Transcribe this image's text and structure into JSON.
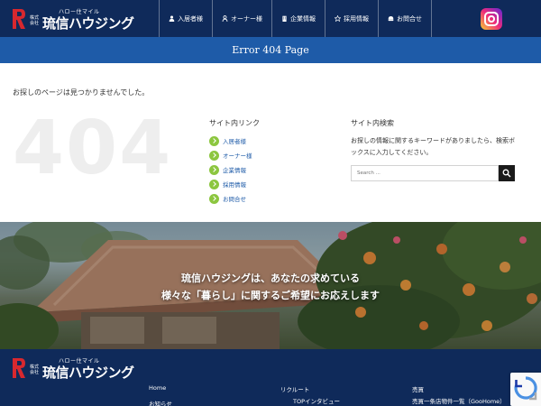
{
  "header": {
    "logo_tagline": "ハロー住マイル",
    "logo_small": "株式会社",
    "logo_name": "琉信ハウジング",
    "nav": [
      {
        "label": "入居者様",
        "icon": "person-icon"
      },
      {
        "label": "オーナー様",
        "icon": "owner-icon"
      },
      {
        "label": "企業情報",
        "icon": "building-icon"
      },
      {
        "label": "採用情報",
        "icon": "star-icon"
      },
      {
        "label": "お問合せ",
        "icon": "contact-icon"
      }
    ],
    "social_icon": "instagram-icon"
  },
  "title_band": {
    "title": "Error 404 Page"
  },
  "content": {
    "not_found_message": "お探しのページは見つかりませんでした。",
    "big_number": "404",
    "links_heading": "サイト内リンク",
    "links": [
      "入居者様",
      "オーナー様",
      "企業情報",
      "採用情報",
      "お問合せ"
    ],
    "search_heading": "サイト内検索",
    "search_description": "お探しの情報に関するキーワードがありましたら、検索ボックスに入力してください。",
    "search_placeholder": "Search ..."
  },
  "banner": {
    "line1": "琉信ハウジングは、あなたの求めている",
    "line2": "様々な「暮らし」に関するご希望にお応えします"
  },
  "footer": {
    "col1": [
      "Home",
      "お知らせ"
    ],
    "col2": [
      "リクルート",
      "TOPインタビュー"
    ],
    "col3": [
      "売買",
      "売買一条店物件一覧（GooHome）"
    ]
  },
  "colors": {
    "header_bg": "#0f2a5a",
    "title_band_bg": "#1e5ba8",
    "link_color": "#1e5ba8",
    "bullet_green": "#8cc63f",
    "logo_red": "#d7282f"
  }
}
